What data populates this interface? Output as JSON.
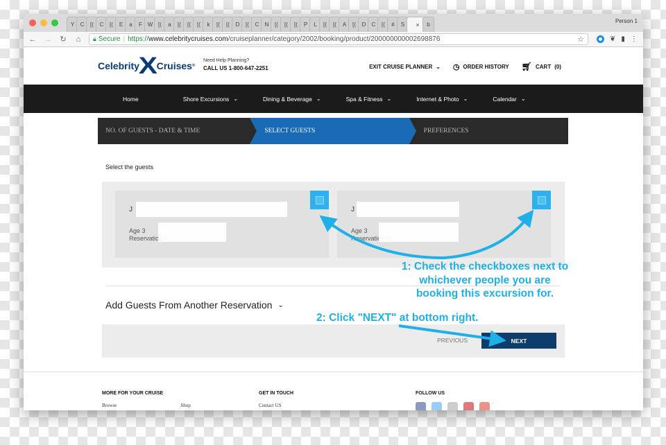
{
  "browser": {
    "tabs": [
      "Y",
      "C",
      "[(",
      "C",
      "[(",
      "E",
      "a",
      "F",
      "W",
      "[(",
      "a",
      "[(",
      "[(",
      "[(",
      "k",
      "[(",
      "[(",
      "D",
      "[(",
      "C",
      "N",
      "[(",
      "[(",
      "[(",
      "P",
      "L",
      "[(",
      "[(",
      "A",
      "[(",
      "D",
      "C",
      "[(",
      "#",
      "S"
    ],
    "active_tab": {
      "label": "",
      "close": "×"
    },
    "extra_tab": "b",
    "profile": "Person 1",
    "secure_label": "Secure",
    "url_protocol": "https://",
    "url_host": "www.celebritycruises.com",
    "url_path": "/cruiseplanner/category/2002/booking/product/200000000002698876"
  },
  "header": {
    "brand_left": "Celebrity",
    "brand_right": "Cruises",
    "help_question": "Need Help Planning?",
    "help_call": "CALL US 1-800-647-2251",
    "exit_label": "EXIT CRUISE PLANNER",
    "order_history_label": "ORDER HISTORY",
    "cart_label": "CART",
    "cart_count": "(0)"
  },
  "mainnav": [
    {
      "label": "Home",
      "dropdown": false
    },
    {
      "label": "Shore Excursions",
      "dropdown": true
    },
    {
      "label": "Dining & Beverage",
      "dropdown": true
    },
    {
      "label": "Spa & Fitness",
      "dropdown": true
    },
    {
      "label": "Internet & Photo",
      "dropdown": true
    },
    {
      "label": "Calendar",
      "dropdown": true
    }
  ],
  "steps": [
    {
      "label": "NO. OF GUESTS - DATE & TIME",
      "active": false
    },
    {
      "label": "SELECT GUESTS",
      "active": true
    },
    {
      "label": "PREFERENCES",
      "active": false
    }
  ],
  "select_label": "Select the guests",
  "guests": [
    {
      "name_initial": "J",
      "age": "Age 3",
      "reservation": "Reservation 3",
      "checked": false
    },
    {
      "name_initial": "J",
      "age": "Age 3",
      "reservation": "Reservation 3!",
      "checked": false
    }
  ],
  "add_guests_label": "Add Guests From Another Reservation",
  "buttons": {
    "previous": "PREVIOUS",
    "next": "NEXT"
  },
  "footer": {
    "columns": [
      {
        "heading": "MORE FOR YOUR CRUISE",
        "links": [
          "Browse",
          "Shop"
        ]
      },
      {
        "heading": "GET IN TOUCH",
        "links": [
          "Contact US"
        ]
      },
      {
        "heading": "FOLLOW US",
        "links": []
      }
    ],
    "social": [
      "facebook",
      "twitter",
      "youtube",
      "pinterest",
      "google-plus"
    ]
  },
  "annotations": {
    "step1": "1: Check the checkboxes next to whichever people you are booking this excursion for.",
    "step1_lines": [
      "1: Check the checkboxes next to",
      "whichever people you are",
      "booking this excursion for."
    ],
    "step2": "2: Click \"NEXT\" at bottom right."
  },
  "colors": {
    "accent_blue": "#1a6bb5",
    "checkbox_blue": "#2cb2ee",
    "next_button": "#0d3d6b",
    "annotation": "#1fb0e8",
    "nav_bg": "#1b1b1b"
  }
}
